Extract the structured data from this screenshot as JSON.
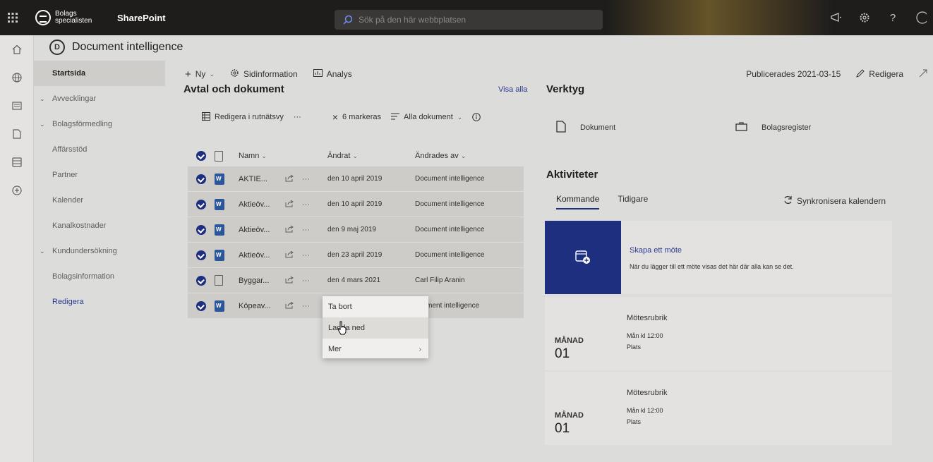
{
  "topbar": {
    "brand_line1": "Bolags",
    "brand_line2": "specialisten",
    "app_name": "SharePoint",
    "search_placeholder": "Sök på den här webbplatsen"
  },
  "site": {
    "title": "Document intelligence",
    "logo_letter": "D"
  },
  "nav": {
    "items": [
      {
        "label": "Startsida",
        "type": "active"
      },
      {
        "label": "Avvecklingar",
        "type": "group"
      },
      {
        "label": "Bolagsförmedling",
        "type": "group"
      },
      {
        "label": "Affärsstöd",
        "type": "item"
      },
      {
        "label": "Partner",
        "type": "item"
      },
      {
        "label": "Kalender",
        "type": "item"
      },
      {
        "label": "Kanalkostnader",
        "type": "item"
      },
      {
        "label": "Kundundersökning",
        "type": "group"
      },
      {
        "label": "Bolagsinformation",
        "type": "item"
      },
      {
        "label": "Redigera",
        "type": "link"
      }
    ]
  },
  "cmdbar": {
    "new_label": "Ny",
    "pageinfo_label": "Sidinformation",
    "analytics_label": "Analys",
    "published_label": "Publicerades 2021-03-15",
    "edit_label": "Redigera"
  },
  "library": {
    "title": "Avtal och dokument",
    "view_all": "Visa alla",
    "edit_grid": "Redigera i rutnätsvy",
    "selected": "6 markeras",
    "view_name": "Alla dokument",
    "columns": {
      "name": "Namn",
      "modified": "Ändrat",
      "modified_by": "Ändrades av"
    },
    "rows": [
      {
        "name": "AKTIE...",
        "type": "word",
        "modified": "den 10 april 2019",
        "by": "Document intelligence"
      },
      {
        "name": "Aktieöv...",
        "type": "word",
        "modified": "den 10 april 2019",
        "by": "Document intelligence"
      },
      {
        "name": "Aktieöv...",
        "type": "word",
        "modified": "den 9 maj 2019",
        "by": "Document intelligence"
      },
      {
        "name": "Aktieöv...",
        "type": "word",
        "modified": "den 23 april 2019",
        "by": "Document intelligence"
      },
      {
        "name": "Byggar...",
        "type": "blank",
        "modified": "den 4 mars 2021",
        "by": "Carl Filip Aranin"
      },
      {
        "name": "Köpeav...",
        "type": "word",
        "modified": "",
        "by": "ocument intelligence"
      }
    ]
  },
  "context_menu": {
    "delete": "Ta bort",
    "download": "Ladda ned",
    "more": "Mer"
  },
  "tools": {
    "title": "Verktyg",
    "doc_label": "Dokument",
    "registry_label": "Bolagsregister"
  },
  "activities": {
    "title": "Aktiviteter",
    "tab_upcoming": "Kommande",
    "tab_past": "Tidigare",
    "sync": "Synkronisera kalendern",
    "create_title": "Skapa ett möte",
    "create_desc": "När du lägger till ett möte visas det här där alla kan se det.",
    "events": [
      {
        "month": "MÅNAD",
        "day": "01",
        "title": "Mötesrubrik",
        "time": "Mån kl 12:00",
        "place": "Plats"
      },
      {
        "month": "MÅNAD",
        "day": "01",
        "title": "Mötesrubrik",
        "time": "Mån kl 12:00",
        "place": "Plats"
      }
    ]
  },
  "colors": {
    "accent": "#1f2f80",
    "topbar": "#1e1d1b",
    "link": "#2b3a8f"
  }
}
